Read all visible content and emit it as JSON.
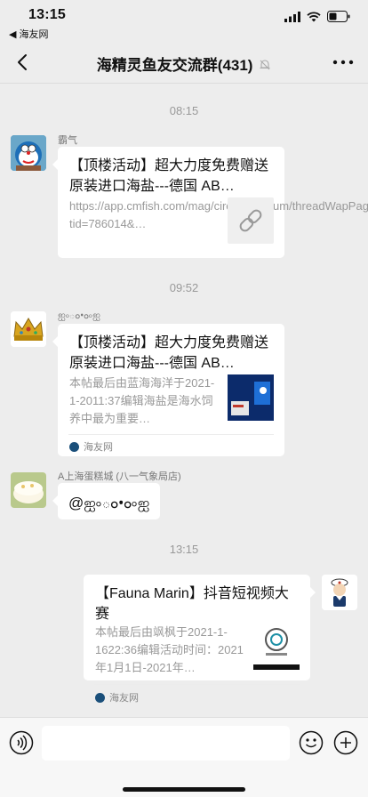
{
  "status_bar": {
    "time": "13:15",
    "back_app": "◀ 海友网"
  },
  "header": {
    "title": "海精灵鱼友交流群(431)"
  },
  "messages": [
    {
      "timestamp": "08:15",
      "sender": "霸气",
      "card": {
        "title": "【顶楼活动】超大力度免费赠送原装进口海盐---德国 AB…",
        "desc": "https://app.cmfish.com/mag/circle/v1/forum/threadWapPage?tid=786014&…"
      }
    },
    {
      "timestamp": "09:52",
      "sender": "ஐ৹ం•ం৹ஐ",
      "card": {
        "title": "【顶楼活动】超大力度免费赠送原装进口海盐---德国 AB…",
        "desc": "本帖最后由蓝海海洋于2021-1-2011:37编辑海盐是海水饲养中最为重要…",
        "source": "海友网"
      }
    },
    {
      "sender": "A上海蛋糕城 (八一气象局店)",
      "text": "@ஐ৹ం•ం৹ஐ"
    },
    {
      "timestamp": "13:15",
      "card": {
        "title": "【Fauna Marin】抖音短视频大赛",
        "desc": "本帖最后由飒枫于2021-1-1622:36编辑活动时间：2021年1月1日-2021年…",
        "source": "海友网"
      }
    }
  ],
  "input": {
    "value": "",
    "placeholder": ""
  }
}
